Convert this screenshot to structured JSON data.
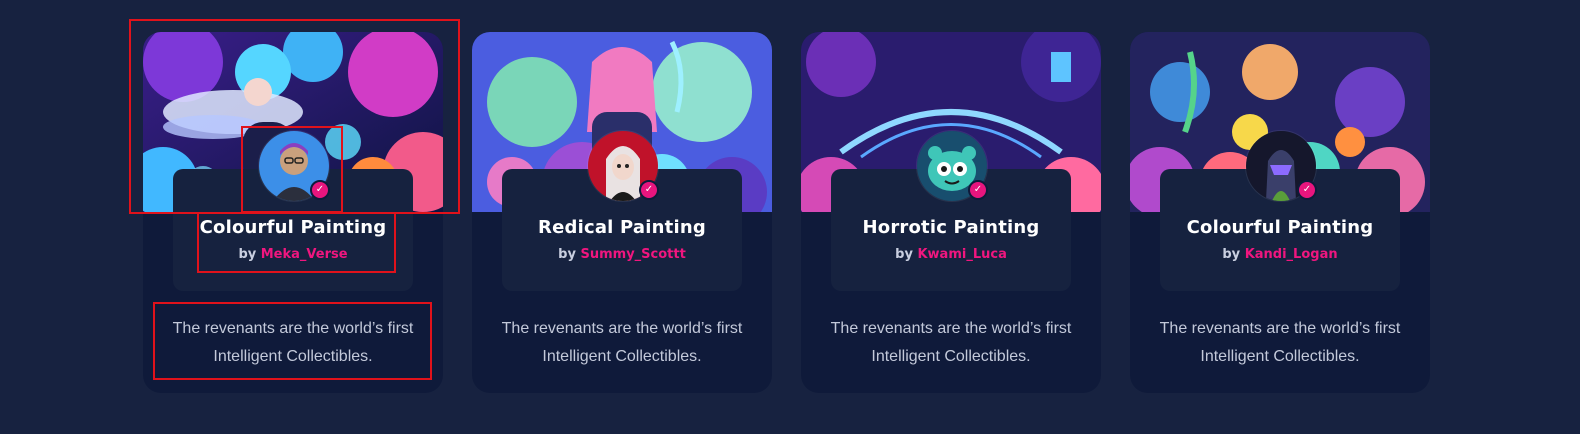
{
  "cards": [
    {
      "title": "Colourful Painting",
      "by": "by",
      "author": "Meka_Verse",
      "desc_line1": "The revenants are the world’s first",
      "desc_line2": "Intelligent Collectibles."
    },
    {
      "title": "Redical Painting",
      "by": "by",
      "author": "Summy_Scottt",
      "desc_line1": "The revenants are the world’s first",
      "desc_line2": "Intelligent Collectibles."
    },
    {
      "title": "Horrotic Painting",
      "by": "by",
      "author": "Kwami_Luca",
      "desc_line1": "The revenants are the world’s first",
      "desc_line2": "Intelligent Collectibles."
    },
    {
      "title": "Colourful Painting",
      "by": "by",
      "author": "Kandi_Logan",
      "desc_line1": "The revenants are the world’s first",
      "desc_line2": "Intelligent Collectibles."
    }
  ],
  "icons": {
    "verified": "verified-check-icon"
  },
  "colors": {
    "page_bg": "#172240",
    "card_bg": "#0f1a3a",
    "info_box_bg": "#16223f",
    "accent_pink": "#f0167f",
    "annotation_red": "#e0121b"
  }
}
